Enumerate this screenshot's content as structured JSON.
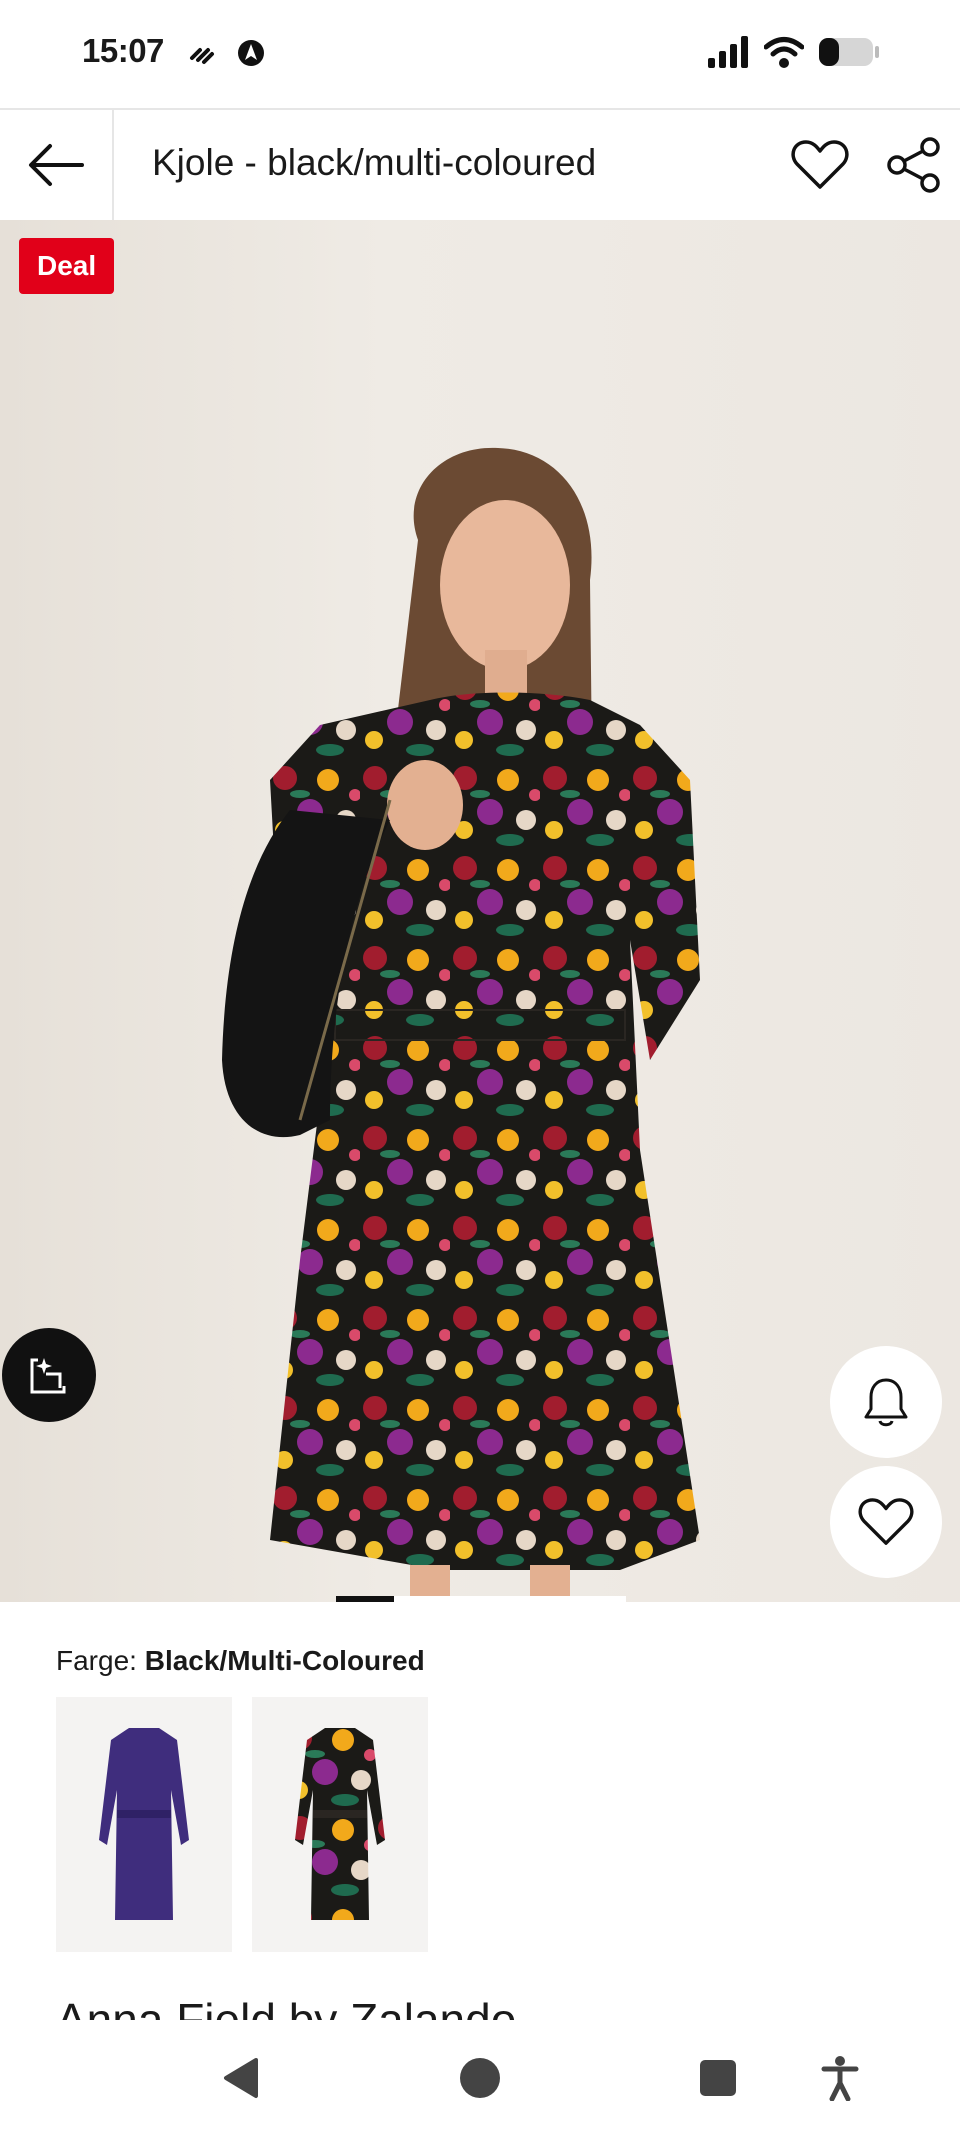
{
  "status_bar": {
    "time": "15:07",
    "icons": [
      "link-icon",
      "nav-arrow-icon",
      "signal-icon",
      "wifi-icon",
      "battery-icon"
    ]
  },
  "app_bar": {
    "title": "Kjole - black/multi-coloured",
    "icons": [
      "back-arrow-icon",
      "heart-icon",
      "share-icon"
    ]
  },
  "product": {
    "badge": "Deal",
    "icons": [
      "image-scan-icon",
      "bell-icon",
      "heart-icon"
    ],
    "image_index": 1,
    "image_count": 5
  },
  "colour": {
    "label": "Farge:",
    "value": "Black/Multi-Coloured",
    "swatches": [
      "purple",
      "black/multi-coloured"
    ]
  },
  "brand": "Anna Field by Zalando",
  "nav": {
    "icons": [
      "back-triangle-icon",
      "home-circle-icon",
      "recents-square-icon",
      "accessibility-icon"
    ]
  },
  "colors": {
    "accent": "#e10019",
    "text": "#1a1a1a",
    "divider": "#e6e6e6"
  }
}
